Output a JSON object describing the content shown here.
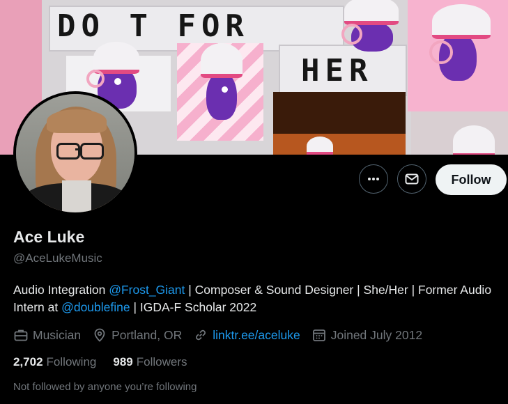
{
  "banner": {
    "headline_line1": "DO T FOR",
    "headline_line2": "HER"
  },
  "profile": {
    "name": "Ace Luke",
    "handle": "@AceLukeMusic",
    "bio_parts": {
      "p1": "Audio Integration ",
      "mention1": "@Frost_Giant",
      "p2": " | Composer & Sound Designer | She/Her | Former Audio Intern at ",
      "mention2": "@doublefine",
      "p3": " | IGDA-F Scholar 2022"
    },
    "meta": {
      "profession": "Musician",
      "location": "Portland, OR",
      "website": "linktr.ee/aceluke",
      "joined": "Joined July 2012"
    },
    "counts": {
      "following_count": "2,702",
      "following_label": "Following",
      "followers_count": "989",
      "followers_label": "Followers"
    },
    "not_followed_text": "Not followed by anyone you’re following"
  },
  "actions": {
    "more_icon": "more-icon",
    "message_icon": "mail-icon",
    "follow_label": "Follow"
  },
  "colors": {
    "background": "#000000",
    "text_primary": "#e7e9ea",
    "text_secondary": "#71767b",
    "link": "#1d9bf0",
    "follow_button_bg": "#eff3f4"
  }
}
